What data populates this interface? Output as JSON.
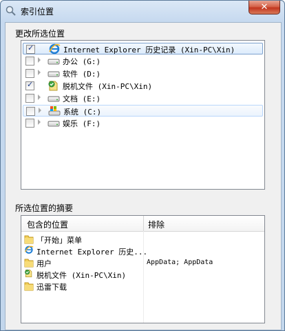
{
  "window": {
    "title": "索引位置",
    "close_label": "✕"
  },
  "change_section": {
    "label": "更改所选位置"
  },
  "tree_items": [
    {
      "label": "Internet Explorer 历史记录 (Xin-PC\\Xin)",
      "checked": true,
      "icon": "ie-icon",
      "expandable": false,
      "state": "selected"
    },
    {
      "label": "办公 (G:)",
      "checked": false,
      "icon": "drive-icon",
      "expandable": true,
      "state": ""
    },
    {
      "label": "软件 (D:)",
      "checked": false,
      "icon": "drive-icon",
      "expandable": true,
      "state": ""
    },
    {
      "label": "脱机文件 (Xin-PC\\Xin)",
      "checked": true,
      "icon": "offline-files-icon",
      "expandable": false,
      "state": ""
    },
    {
      "label": "文档 (E:)",
      "checked": false,
      "icon": "drive-icon",
      "expandable": true,
      "state": ""
    },
    {
      "label": "系统 (C:)",
      "checked": false,
      "icon": "system-drive-icon",
      "expandable": true,
      "state": "hover"
    },
    {
      "label": "娱乐 (F:)",
      "checked": false,
      "icon": "drive-icon",
      "expandable": true,
      "state": ""
    }
  ],
  "summary_section": {
    "label": "所选位置的摘要",
    "columns": [
      "包含的位置",
      "排除"
    ],
    "rows": [
      {
        "label": "「开始」菜单",
        "icon": "folder-icon"
      },
      {
        "label": "Internet Explorer 历史...",
        "icon": "ie-icon"
      },
      {
        "label": "用户",
        "icon": "folder-icon"
      },
      {
        "label": "脱机文件 (Xin-PC\\Xin)",
        "icon": "offline-files-icon"
      },
      {
        "label": "迅雷下载",
        "icon": "folder-icon"
      }
    ],
    "exclusions": "AppData; AppData"
  }
}
